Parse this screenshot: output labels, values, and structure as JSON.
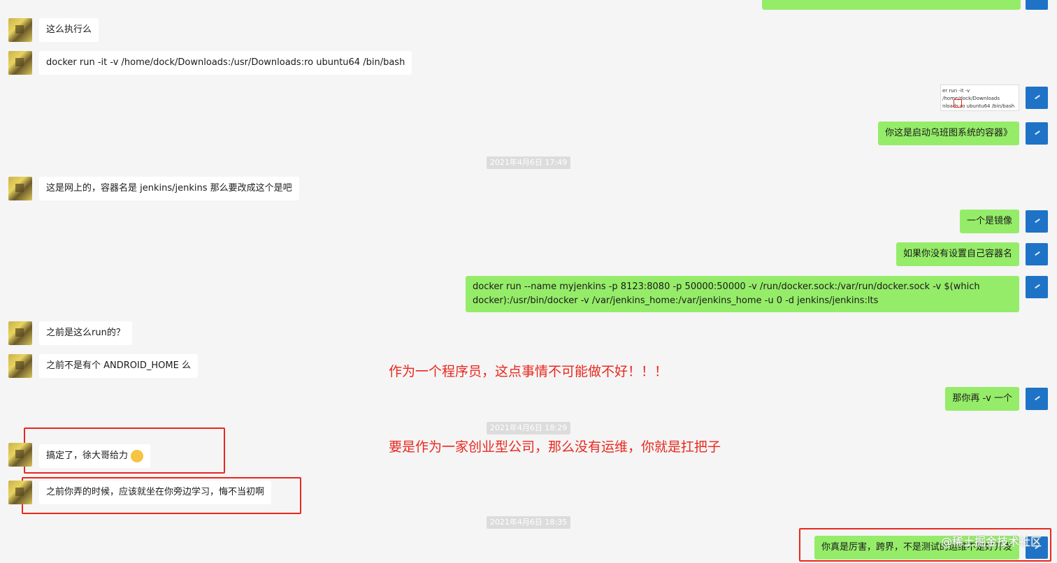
{
  "messages": {
    "m1": "这么执行么",
    "m2": "docker run -it -v /home/dock/Downloads:/usr/Downloads:ro ubuntu64 /bin/bash",
    "m3_thumb_line1": "er run -it -v /home/dock/Downloads",
    "m3_thumb_line2": "nloads:ro ubuntu64 /bin/bash",
    "m4": "你这是启动乌班图系统的容器》",
    "m5": "这是网上的，容器名是 jenkins/jenkins 那么要改成这个是吧",
    "m6": "一个是镜像",
    "m7": "如果你没有设置自己容器名",
    "m8": "docker run --name myjenkins -p 8123:8080 -p 50000:50000 -v /run/docker.sock:/var/run/docker.sock -v $(which docker):/usr/bin/docker -v /var/jenkins_home:/var/jenkins_home -u 0 -d jenkins/jenkins:lts",
    "m9": "之前是这么run的？",
    "m10": "之前不是有个 ANDROID_HOME 么",
    "m11": "那你再 -v 一个",
    "m12": "搞定了，徐大哥给力",
    "m13": "之前你弄的时候，应该就坐在你旁边学习，悔不当初啊",
    "m14": "你真是厉害，跨界，不是测试的运维不是好开发"
  },
  "timestamps": {
    "t1": "2021年4月6日 17:49",
    "t2": "2021年4月6日 18:29",
    "t3": "2021年4月6日 18:35"
  },
  "annotations": {
    "a1": "作为一个程序员，这点事情不可能做不好！！！",
    "a2": "要是作为一家创业型公司，那么没有运维，你就是扛把子"
  },
  "watermark": "@稀土掘金技术社区",
  "colors": {
    "sent_bubble": "#95ec69",
    "recv_bubble": "#ffffff",
    "annotation_red": "#e8281e",
    "self_avatar": "#1e73c6"
  }
}
